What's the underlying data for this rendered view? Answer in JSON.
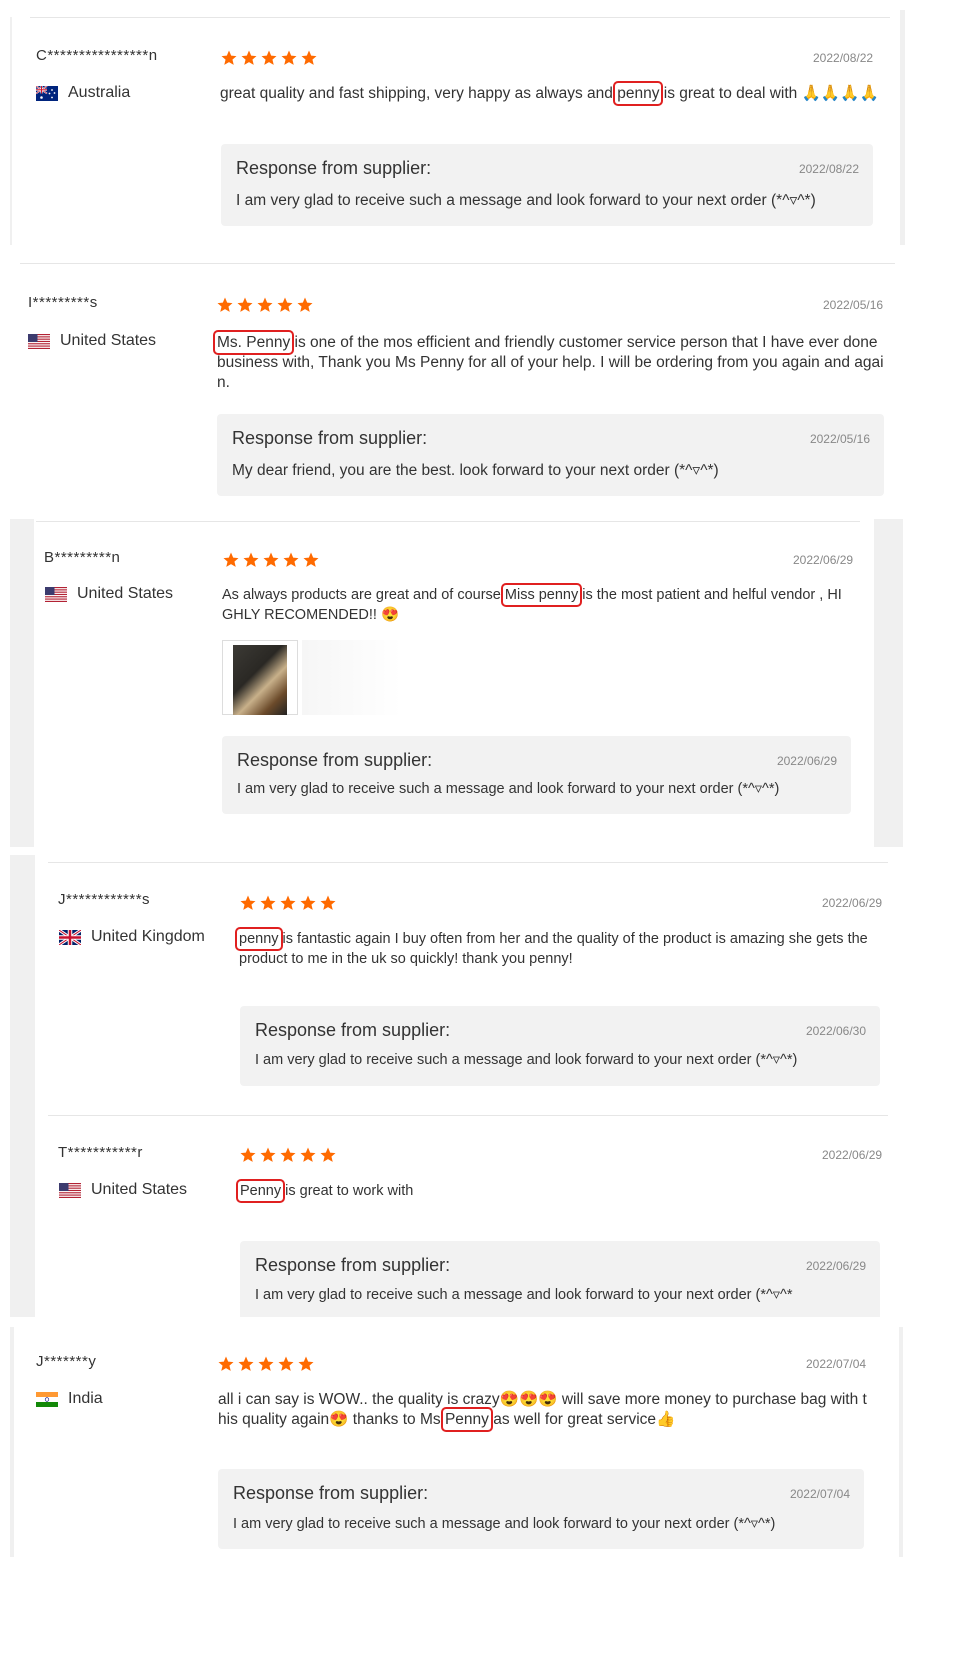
{
  "colors": {
    "star": "#ff6a00",
    "highlight": "#e02020",
    "response_bg": "#f2f2f2"
  },
  "response_title": "Response from supplier:",
  "reviews": [
    {
      "name": "C****************n",
      "country": "Australia",
      "flag": "australia-flag",
      "stars": 5,
      "date": "2022/08/22",
      "text_before": "great quality and fast shipping, very happy as always and ",
      "highlight": "penny",
      "text_after": " is great to deal with 🙏🙏🙏🙏",
      "response_date": "2022/08/22",
      "response_text": "I am very glad to receive such a message and look forward to your next order (*^▿^*)"
    },
    {
      "name": "I*********s",
      "country": "United States",
      "flag": "us-flag",
      "stars": 5,
      "date": "2022/05/16",
      "text_before": "",
      "highlight": "Ms. Penny",
      "text_after": " is one of the mos efficient and friendly customer service person that I have ever done business with, Thank you Ms Penny for all of your help. I will be ordering from you again and again.",
      "response_date": "2022/05/16",
      "response_text": "My dear friend, you are the best. look forward to your next order (*^▿^*)"
    },
    {
      "name": "B*********n",
      "country": "United States",
      "flag": "us-flag",
      "stars": 5,
      "date": "2022/06/29",
      "text_before": "As always products are great and of course ",
      "highlight": "Miss penny",
      "text_after": " is the most patient and helful vendor , HIGHLY RECOMENDED!! 😍",
      "response_date": "2022/06/29",
      "response_text": "I am very glad to receive such a message and look forward to your next order (*^▿^*)"
    },
    {
      "name": "J************s",
      "country": "United Kingdom",
      "flag": "uk-flag",
      "stars": 5,
      "date": "2022/06/29",
      "text_before": "",
      "highlight": "penny",
      "text_after": " is fantastic again I buy often from her and the quality of the product is amazing she gets the product to me in the uk so quickly! thank you penny!",
      "response_date": "2022/06/30",
      "response_text": "I am very glad to receive such a message and look forward to your next order (*^▿^*)"
    },
    {
      "name": "T***********r",
      "country": "United States",
      "flag": "us-flag",
      "stars": 5,
      "date": "2022/06/29",
      "text_before": "",
      "highlight": "Penny",
      "text_after": " is great to work with",
      "response_date": "2022/06/29",
      "response_text": "I am very glad to receive such a message and look forward to your next order (*^▿^*"
    },
    {
      "name": "J*******y",
      "country": "India",
      "flag": "india-flag",
      "stars": 5,
      "date": "2022/07/04",
      "text_before": "all i can say is WOW.. the quality is crazy😍😍😍 will save more money to purchase bag with this quality again😍 thanks to Ms ",
      "highlight": "Penny",
      "text_after": " as well for great service👍",
      "response_date": "2022/07/04",
      "response_text": "I am very glad to receive such a message and look forward to your next order (*^▿^*)"
    }
  ]
}
